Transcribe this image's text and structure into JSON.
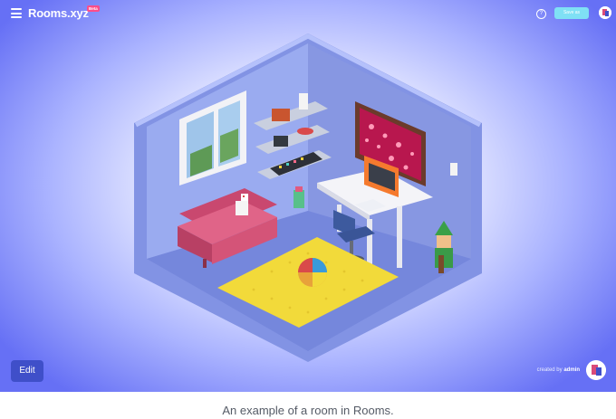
{
  "header": {
    "logo": "Rooms.xyz",
    "badge": "Beta",
    "help_icon": "?",
    "save_label": "Save as"
  },
  "icons": [
    "menu-icon",
    "help-icon",
    "avatar-icon"
  ],
  "footer": {
    "edit_label": "Edit",
    "created_by_label": "created by",
    "creator": "admin"
  },
  "caption": "An example of a room in Rooms.",
  "colors": {
    "background_edge": "#6670f5",
    "room_wall": "#8ea1ea",
    "room_floor": "#7b8fe0",
    "sofa": "#d9577d",
    "rug": "#f2da3a",
    "desk": "#f4f4f8",
    "save_button": "#7fe0f5",
    "edit_button": "#3f4fc9"
  }
}
